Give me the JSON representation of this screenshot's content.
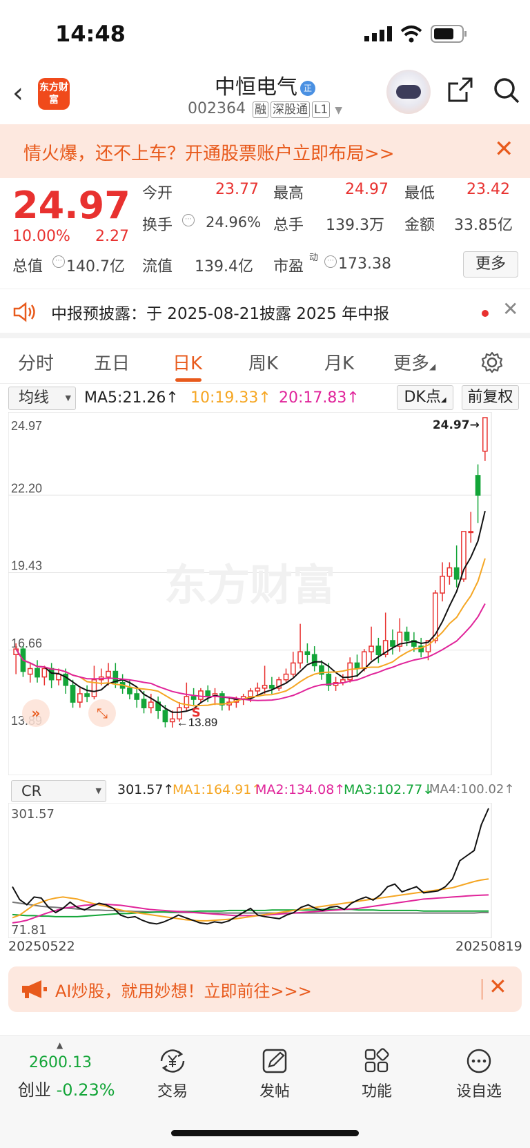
{
  "status_bar": {
    "time": "14:48"
  },
  "header": {
    "logo_text": "东方财富",
    "stock_name": "中恒电气",
    "badge": "正",
    "code": "002364",
    "tags": [
      "融",
      "深股通",
      "L1"
    ]
  },
  "banner": {
    "text": "情火爆，还不上车？开通股票账户立即布局>>"
  },
  "quote": {
    "price": "24.97",
    "change_pct": "10.00%",
    "change_amt": "2.27",
    "fields": [
      {
        "label": "今开",
        "value": "23.77",
        "red": true
      },
      {
        "label": "最高",
        "value": "24.97",
        "red": true
      },
      {
        "label": "最低",
        "value": "23.42",
        "red": true
      },
      {
        "label": "换手",
        "value": "24.96%"
      },
      {
        "label": "总手",
        "value": "139.3万"
      },
      {
        "label": "金额",
        "value": "33.85亿"
      },
      {
        "label": "总值",
        "value": "140.7亿"
      },
      {
        "label": "流值",
        "value": "139.4亿"
      },
      {
        "label": "市盈",
        "sup": "动",
        "value": "173.38"
      }
    ],
    "more_label": "更多"
  },
  "notice": {
    "text": "中报预披露：于 2025-08-21披露 2025 年中报"
  },
  "tabs": [
    "分时",
    "五日",
    "日K",
    "周K",
    "月K",
    "更多"
  ],
  "active_tab": "日K",
  "ma_bar": {
    "selector": "均线",
    "items": [
      {
        "text": "MA5:21.26↑",
        "color": "#222222"
      },
      {
        "text": "10:19.33↑",
        "color": "#f5a623"
      },
      {
        "text": "20:17.83↑",
        "color": "#e0249a"
      }
    ],
    "dk_label": "DK点",
    "fq_label": "前复权"
  },
  "kline": {
    "y_labels": [
      "24.97",
      "22.20",
      "19.43",
      "16.66",
      "13.89"
    ],
    "high_label": "24.97→",
    "low_label": "←13.89",
    "watermark": "东方财富",
    "s_marker": "S"
  },
  "cr_bar": {
    "selector": "CR",
    "items": [
      {
        "text": "301.57↑",
        "color": "#222222"
      },
      {
        "text": "MA1:164.91↑",
        "color": "#f5a623"
      },
      {
        "text": "MA2:134.08↑",
        "color": "#e0249a"
      },
      {
        "text": "MA3:102.77↓",
        "color": "#13a538"
      },
      {
        "text": "MA4:100.02↑",
        "color": "#777777"
      }
    ],
    "y_top": "301.57",
    "y_bottom": "71.81"
  },
  "dates": {
    "start": "20250522",
    "end": "20250819"
  },
  "ad": {
    "text": "AI炒股，就用妙想！立即前往>>>"
  },
  "bottom_nav": {
    "index_value": "2600.13",
    "index_name": "创业",
    "index_change": "-0.23%",
    "items": [
      "交易",
      "发帖",
      "功能",
      "设自选"
    ]
  },
  "chart_data": {
    "type": "candlestick",
    "title": "中恒电气 日K",
    "ylim": [
      13.89,
      24.97
    ],
    "y_ticks": [
      24.97,
      22.2,
      19.43,
      16.66,
      13.89
    ],
    "x_range": [
      "20250522",
      "20250819"
    ],
    "series": [
      {
        "name": "MA5",
        "last": 21.26
      },
      {
        "name": "MA10",
        "last": 19.33
      },
      {
        "name": "MA20",
        "last": 17.83
      }
    ],
    "candles": [
      [
        16.5,
        16.9,
        16.7,
        15.8
      ],
      [
        16.7,
        16.8,
        15.9,
        15.7
      ],
      [
        15.8,
        16.2,
        16.0,
        15.5
      ],
      [
        16.0,
        16.3,
        15.7,
        15.5
      ],
      [
        15.7,
        16.1,
        16.0,
        15.4
      ],
      [
        16.0,
        16.2,
        15.6,
        15.3
      ],
      [
        15.6,
        16.0,
        15.8,
        15.4
      ],
      [
        15.8,
        16.0,
        15.4,
        15.1
      ],
      [
        15.4,
        15.6,
        14.8,
        14.6
      ],
      [
        14.8,
        15.3,
        15.1,
        14.6
      ],
      [
        15.1,
        15.4,
        15.0,
        14.8
      ],
      [
        15.0,
        16.1,
        15.6,
        14.9
      ],
      [
        15.6,
        16.0,
        15.7,
        15.4
      ],
      [
        15.7,
        16.2,
        15.9,
        15.4
      ],
      [
        15.9,
        16.2,
        15.5,
        15.3
      ],
      [
        15.5,
        15.8,
        15.3,
        15.1
      ],
      [
        15.3,
        15.6,
        15.1,
        14.9
      ],
      [
        15.1,
        15.3,
        14.9,
        14.6
      ],
      [
        14.9,
        15.2,
        14.6,
        14.4
      ],
      [
        14.6,
        15.1,
        14.8,
        14.4
      ],
      [
        14.8,
        15.0,
        14.5,
        14.2
      ],
      [
        14.5,
        14.7,
        14.1,
        13.9
      ],
      [
        14.1,
        14.5,
        14.2,
        13.89
      ],
      [
        14.2,
        14.8,
        14.6,
        14.1
      ],
      [
        14.6,
        15.5,
        15.0,
        14.5
      ],
      [
        15.0,
        15.3,
        14.9,
        14.7
      ],
      [
        14.9,
        15.3,
        15.2,
        14.8
      ],
      [
        15.2,
        15.4,
        15.0,
        14.8
      ],
      [
        15.0,
        15.3,
        15.1,
        14.7
      ],
      [
        15.1,
        15.2,
        14.7,
        14.5
      ],
      [
        14.7,
        15.0,
        14.8,
        14.5
      ],
      [
        14.8,
        15.0,
        14.9,
        14.6
      ],
      [
        14.9,
        15.1,
        15.0,
        14.7
      ],
      [
        15.0,
        15.3,
        15.2,
        14.8
      ],
      [
        15.2,
        15.5,
        15.3,
        15.0
      ],
      [
        15.3,
        16.1,
        15.4,
        15.1
      ],
      [
        15.4,
        15.7,
        15.3,
        15.1
      ],
      [
        15.3,
        15.7,
        15.6,
        15.2
      ],
      [
        15.6,
        16.0,
        15.8,
        15.5
      ],
      [
        15.8,
        16.6,
        16.2,
        15.7
      ],
      [
        16.2,
        17.6,
        16.6,
        16.0
      ],
      [
        16.6,
        16.9,
        16.5,
        16.2
      ],
      [
        16.5,
        16.8,
        16.1,
        15.9
      ],
      [
        16.1,
        16.3,
        15.8,
        15.6
      ],
      [
        15.8,
        16.2,
        15.4,
        15.2
      ],
      [
        15.4,
        15.7,
        15.5,
        15.2
      ],
      [
        15.5,
        15.8,
        15.6,
        15.4
      ],
      [
        15.6,
        16.4,
        16.2,
        15.5
      ],
      [
        16.2,
        16.5,
        16.0,
        15.7
      ],
      [
        16.0,
        16.7,
        16.6,
        15.9
      ],
      [
        16.6,
        17.5,
        16.8,
        16.3
      ],
      [
        16.8,
        17.1,
        16.5,
        16.2
      ],
      [
        16.5,
        18.0,
        17.0,
        16.4
      ],
      [
        17.0,
        17.4,
        16.8,
        16.5
      ],
      [
        16.8,
        17.8,
        17.3,
        16.6
      ],
      [
        17.3,
        17.5,
        17.0,
        16.8
      ],
      [
        17.0,
        17.3,
        16.8,
        16.6
      ],
      [
        16.8,
        17.1,
        16.6,
        16.4
      ],
      [
        16.6,
        16.9,
        17.0,
        16.3
      ],
      [
        17.0,
        18.8,
        18.7,
        16.9
      ],
      [
        18.7,
        19.8,
        19.3,
        18.4
      ],
      [
        19.3,
        19.8,
        19.6,
        19.0
      ],
      [
        19.6,
        20.4,
        19.2,
        18.9
      ],
      [
        19.2,
        20.8,
        20.9,
        19.1
      ],
      [
        20.9,
        21.6,
        20.9,
        20.5
      ],
      [
        22.9,
        23.3,
        22.2,
        21.2
      ],
      [
        23.77,
        24.97,
        24.97,
        23.42
      ]
    ],
    "cr": {
      "ylim": [
        71.81,
        301.57
      ],
      "cr_line": [
        150,
        125,
        115,
        130,
        128,
        110,
        100,
        108,
        120,
        110,
        105,
        112,
        118,
        115,
        108,
        95,
        90,
        92,
        85,
        80,
        78,
        82,
        88,
        95,
        90,
        85,
        80,
        78,
        82,
        80,
        84,
        92,
        100,
        108,
        95,
        92,
        90,
        88,
        95,
        100,
        110,
        115,
        108,
        104,
        110,
        112,
        106,
        118,
        125,
        130,
        124,
        134,
        150,
        155,
        140,
        145,
        150,
        138,
        140,
        142,
        150,
        165,
        200,
        210,
        220,
        270,
        301.57
      ],
      "ma1": [
        90,
        95,
        105,
        115,
        120,
        125,
        128,
        130,
        128,
        126,
        122,
        118,
        115,
        112,
        108,
        105,
        102,
        100,
        98,
        96,
        94,
        92,
        90,
        88,
        86,
        85,
        84,
        84,
        85,
        86,
        87,
        88,
        90,
        92,
        94,
        96,
        98,
        100,
        102,
        104,
        106,
        108,
        110,
        112,
        114,
        116,
        118,
        120,
        122,
        124,
        126,
        128,
        130,
        132,
        134,
        136,
        138,
        140,
        142,
        144,
        146,
        148,
        152,
        156,
        160,
        163,
        164.91
      ],
      "ma2": [
        80,
        82,
        85,
        90,
        95,
        100,
        104,
        108,
        110,
        112,
        114,
        115,
        116,
        116,
        115,
        114,
        112,
        110,
        108,
        106,
        105,
        104,
        103,
        102,
        101,
        100,
        99,
        98,
        97,
        96,
        95,
        94,
        94,
        94,
        94,
        95,
        96,
        97,
        98,
        99,
        100,
        101,
        102,
        103,
        104,
        105,
        106,
        107,
        108,
        110,
        112,
        114,
        116,
        118,
        120,
        122,
        124,
        126,
        127,
        128,
        129,
        130,
        131,
        132,
        133,
        133.5,
        134.08
      ],
      "ma3": [
        96,
        95,
        94,
        94,
        93,
        93,
        92,
        92,
        92,
        92,
        93,
        94,
        95,
        96,
        97,
        98,
        98,
        99,
        100,
        100,
        101,
        101,
        101,
        102,
        102,
        102,
        103,
        103,
        103,
        103,
        104,
        104,
        104,
        104,
        104,
        104,
        105,
        105,
        105,
        105,
        105,
        105,
        105,
        106,
        106,
        106,
        106,
        106,
        105,
        105,
        105,
        104,
        104,
        104,
        104,
        104,
        104,
        103,
        103,
        103,
        103,
        103,
        103,
        103,
        103,
        103,
        102.77
      ],
      "ma4": [
        120,
        118,
        116,
        114,
        112,
        111,
        110,
        109,
        108,
        107,
        106,
        105,
        105,
        104,
        104,
        103,
        103,
        102,
        102,
        101,
        101,
        101,
        100,
        100,
        100,
        100,
        100,
        99,
        99,
        99,
        99,
        99,
        99,
        99,
        99,
        99,
        99,
        99,
        99,
        99,
        99,
        99,
        99,
        99,
        99,
        99,
        99,
        99,
        99,
        99,
        99,
        99,
        99,
        99,
        99,
        99,
        99,
        99,
        99,
        99,
        99,
        99,
        99,
        99,
        99,
        100,
        100.02
      ]
    }
  }
}
